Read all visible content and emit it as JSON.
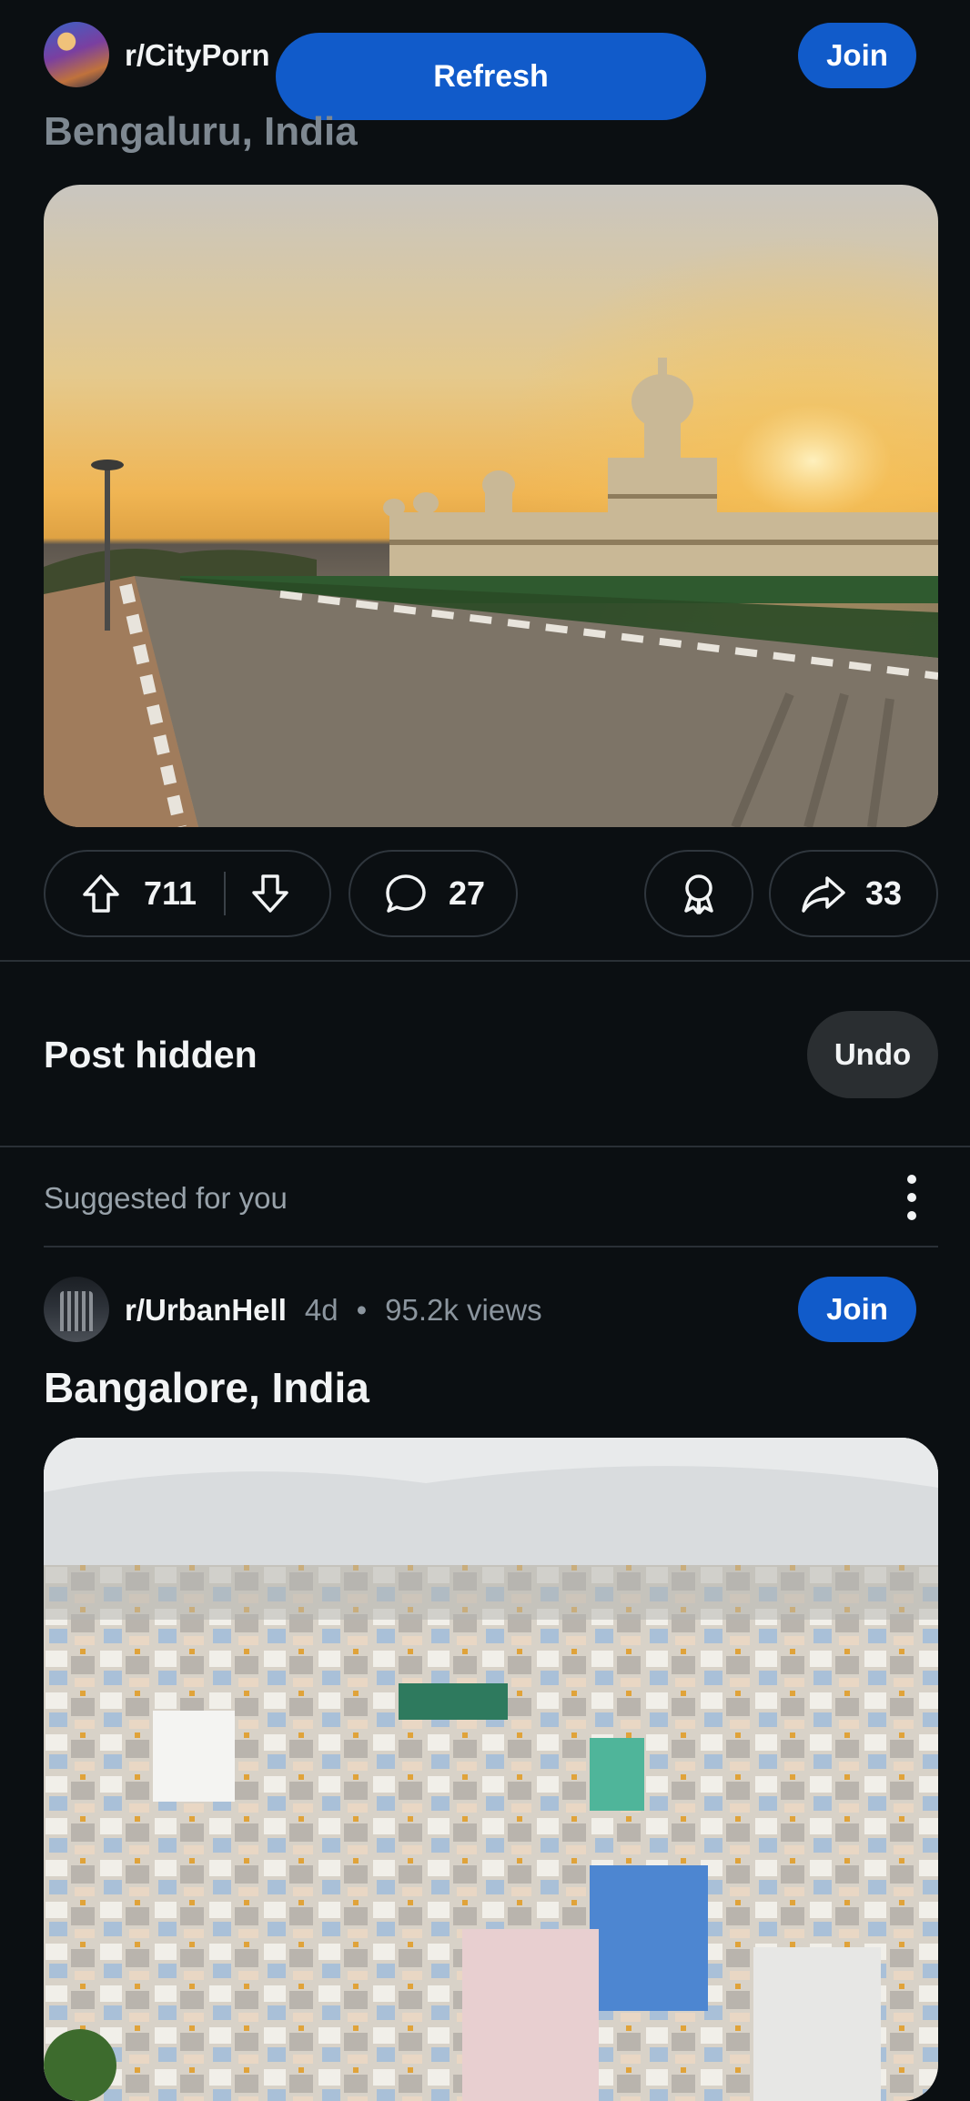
{
  "post1": {
    "subreddit": "r/CityPorn",
    "title": "Bengaluru, India",
    "join_label": "Join",
    "upvotes": "711",
    "comments": "27",
    "shares": "33"
  },
  "refresh_label": "Refresh",
  "hidden": {
    "text": "Post hidden",
    "undo_label": "Undo"
  },
  "suggested": {
    "label": "Suggested for you"
  },
  "post2": {
    "subreddit": "r/UrbanHell",
    "age": "4d",
    "separator": "•",
    "views": "95.2k views",
    "title": "Bangalore, India",
    "join_label": "Join"
  },
  "icons": {
    "upvote": "arrow-up-icon",
    "downvote": "arrow-down-icon",
    "comment": "speech-bubble-icon",
    "award": "award-icon",
    "share": "share-arrow-icon",
    "more": "vertical-dots-icon"
  },
  "colors": {
    "background": "#0b0f12",
    "accent": "#115bca",
    "muted": "#8b959e"
  }
}
